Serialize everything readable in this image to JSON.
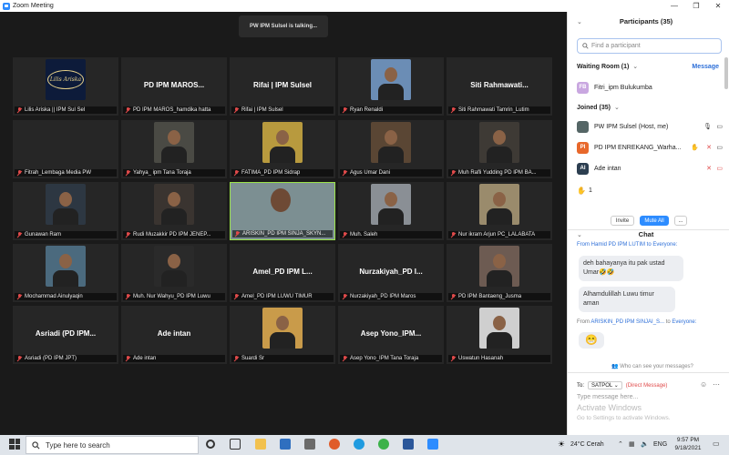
{
  "window": {
    "title": "Zoom Meeting"
  },
  "talking": "PW IPM Sulsel is talking...",
  "tiles": [
    {
      "name": "",
      "label": "Lilis Ariska || IPM Sul Sel",
      "logo": "Lilis Ariska"
    },
    {
      "name": "PD IPM MAROS...",
      "label": "PD IPM MAROS_hamdika hatta"
    },
    {
      "name": "Rifai | IPM Sulsel",
      "label": "Rifai | IPM Sulsel"
    },
    {
      "name": "",
      "label": "Ryan Renaldi"
    },
    {
      "name": "Siti Rahmawati...",
      "label": "Siti Rahmawati Tamrin_Lutim"
    },
    {
      "name": "",
      "label": "Fitrah_Lembaga Media PW"
    },
    {
      "name": "",
      "label": "Yahya_ ipm Tana Toraja"
    },
    {
      "name": "",
      "label": "FATIMA_PD IPM Sidrap"
    },
    {
      "name": "",
      "label": "Agus Umar Dani"
    },
    {
      "name": "",
      "label": "Muh Rafli Yudding PD IPM BA..."
    },
    {
      "name": "",
      "label": "Gunawan Ram"
    },
    {
      "name": "",
      "label": "Rudi Muzakkir PD IPM JENEP..."
    },
    {
      "name": "",
      "label": "ARISKIN_PD IPM SINJA_SKYN..."
    },
    {
      "name": "",
      "label": "Muh. Saleh"
    },
    {
      "name": "",
      "label": "Nur ikram Arjun PC_LALABATA"
    },
    {
      "name": "",
      "label": "Mochammad Ainulyaqin"
    },
    {
      "name": "",
      "label": "Muh. Nur Wahyu_PD IPM Luwu"
    },
    {
      "name": "Amel_PD IPM L...",
      "label": "Amel_PD IPM LUWU TIMUR"
    },
    {
      "name": "Nurzakiyah_PD I...",
      "label": "Nurzakiyah_PD IPM Maros"
    },
    {
      "name": "",
      "label": "PD IPM Bantaeng_Jusma"
    },
    {
      "name": "Asriadi (PD IPM...",
      "label": "Asriadi (PD IPM JPT)"
    },
    {
      "name": "Ade intan",
      "label": "Ade intan"
    },
    {
      "name": "",
      "label": "Suardi Sr"
    },
    {
      "name": "Asep Yono_IPM...",
      "label": "Asep Yono_IPM Tana Toraja"
    },
    {
      "name": "",
      "label": "Uswatun Hasanah"
    }
  ],
  "participants": {
    "title": "Participants (35)",
    "search_placeholder": "Find a participant",
    "waiting_room": "Waiting Room (1)",
    "message": "Message",
    "waiting": [
      {
        "initials": "FB",
        "name": "Fitri_ipm Bulukumba"
      }
    ],
    "joined": "Joined (35)",
    "list": [
      {
        "initials": "",
        "name": "PW IPM Sulsel (Host, me)"
      },
      {
        "initials": "PI",
        "name": "PD IPM ENREKANG_Warha..."
      },
      {
        "initials": "AI",
        "name": "Ade intan"
      }
    ],
    "raised": "1",
    "invite": "Invite",
    "mute_all": "Mute All",
    "more": "..."
  },
  "chat": {
    "title": "Chat",
    "from1": "From Hamid PD IPM LUTIM to Everyone:",
    "msg1": "deh bahayanya itu pak ustad Umar🤣🤣",
    "msg2": "Alhamdulillah Luwu timur aman",
    "from2_prefix": "From",
    "from2_name": "ARISKIN_PD IPM SINJAI_S...",
    "from2_to": "to",
    "from2_everyone": "Everyone:",
    "msg3": "😁",
    "who_can_see": "Who can see your messages?",
    "to_label": "To:",
    "to_value": "SATPOL",
    "direct": "(Direct Message)",
    "placeholder": "Type message here...",
    "activate1": "Activate Windows",
    "activate2": "Go to Settings to activate Windows."
  },
  "taskbar": {
    "search": "Type here to search",
    "weather": "24°C  Cerah",
    "lang": "ENG",
    "time": "9:57 PM",
    "date": "9/18/2021"
  }
}
